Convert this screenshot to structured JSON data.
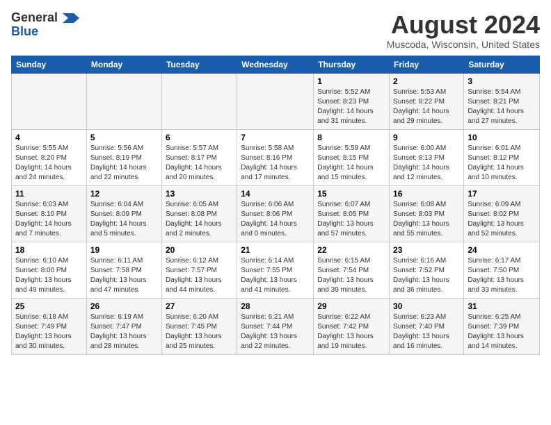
{
  "header": {
    "logo_line1": "General",
    "logo_line2": "Blue",
    "month_year": "August 2024",
    "location": "Muscoda, Wisconsin, United States"
  },
  "days_of_week": [
    "Sunday",
    "Monday",
    "Tuesday",
    "Wednesday",
    "Thursday",
    "Friday",
    "Saturday"
  ],
  "weeks": [
    [
      {
        "day": "",
        "info": ""
      },
      {
        "day": "",
        "info": ""
      },
      {
        "day": "",
        "info": ""
      },
      {
        "day": "",
        "info": ""
      },
      {
        "day": "1",
        "info": "Sunrise: 5:52 AM\nSunset: 8:23 PM\nDaylight: 14 hours\nand 31 minutes."
      },
      {
        "day": "2",
        "info": "Sunrise: 5:53 AM\nSunset: 8:22 PM\nDaylight: 14 hours\nand 29 minutes."
      },
      {
        "day": "3",
        "info": "Sunrise: 5:54 AM\nSunset: 8:21 PM\nDaylight: 14 hours\nand 27 minutes."
      }
    ],
    [
      {
        "day": "4",
        "info": "Sunrise: 5:55 AM\nSunset: 8:20 PM\nDaylight: 14 hours\nand 24 minutes."
      },
      {
        "day": "5",
        "info": "Sunrise: 5:56 AM\nSunset: 8:19 PM\nDaylight: 14 hours\nand 22 minutes."
      },
      {
        "day": "6",
        "info": "Sunrise: 5:57 AM\nSunset: 8:17 PM\nDaylight: 14 hours\nand 20 minutes."
      },
      {
        "day": "7",
        "info": "Sunrise: 5:58 AM\nSunset: 8:16 PM\nDaylight: 14 hours\nand 17 minutes."
      },
      {
        "day": "8",
        "info": "Sunrise: 5:59 AM\nSunset: 8:15 PM\nDaylight: 14 hours\nand 15 minutes."
      },
      {
        "day": "9",
        "info": "Sunrise: 6:00 AM\nSunset: 8:13 PM\nDaylight: 14 hours\nand 12 minutes."
      },
      {
        "day": "10",
        "info": "Sunrise: 6:01 AM\nSunset: 8:12 PM\nDaylight: 14 hours\nand 10 minutes."
      }
    ],
    [
      {
        "day": "11",
        "info": "Sunrise: 6:03 AM\nSunset: 8:10 PM\nDaylight: 14 hours\nand 7 minutes."
      },
      {
        "day": "12",
        "info": "Sunrise: 6:04 AM\nSunset: 8:09 PM\nDaylight: 14 hours\nand 5 minutes."
      },
      {
        "day": "13",
        "info": "Sunrise: 6:05 AM\nSunset: 8:08 PM\nDaylight: 14 hours\nand 2 minutes."
      },
      {
        "day": "14",
        "info": "Sunrise: 6:06 AM\nSunset: 8:06 PM\nDaylight: 14 hours\nand 0 minutes."
      },
      {
        "day": "15",
        "info": "Sunrise: 6:07 AM\nSunset: 8:05 PM\nDaylight: 13 hours\nand 57 minutes."
      },
      {
        "day": "16",
        "info": "Sunrise: 6:08 AM\nSunset: 8:03 PM\nDaylight: 13 hours\nand 55 minutes."
      },
      {
        "day": "17",
        "info": "Sunrise: 6:09 AM\nSunset: 8:02 PM\nDaylight: 13 hours\nand 52 minutes."
      }
    ],
    [
      {
        "day": "18",
        "info": "Sunrise: 6:10 AM\nSunset: 8:00 PM\nDaylight: 13 hours\nand 49 minutes."
      },
      {
        "day": "19",
        "info": "Sunrise: 6:11 AM\nSunset: 7:58 PM\nDaylight: 13 hours\nand 47 minutes."
      },
      {
        "day": "20",
        "info": "Sunrise: 6:12 AM\nSunset: 7:57 PM\nDaylight: 13 hours\nand 44 minutes."
      },
      {
        "day": "21",
        "info": "Sunrise: 6:14 AM\nSunset: 7:55 PM\nDaylight: 13 hours\nand 41 minutes."
      },
      {
        "day": "22",
        "info": "Sunrise: 6:15 AM\nSunset: 7:54 PM\nDaylight: 13 hours\nand 39 minutes."
      },
      {
        "day": "23",
        "info": "Sunrise: 6:16 AM\nSunset: 7:52 PM\nDaylight: 13 hours\nand 36 minutes."
      },
      {
        "day": "24",
        "info": "Sunrise: 6:17 AM\nSunset: 7:50 PM\nDaylight: 13 hours\nand 33 minutes."
      }
    ],
    [
      {
        "day": "25",
        "info": "Sunrise: 6:18 AM\nSunset: 7:49 PM\nDaylight: 13 hours\nand 30 minutes."
      },
      {
        "day": "26",
        "info": "Sunrise: 6:19 AM\nSunset: 7:47 PM\nDaylight: 13 hours\nand 28 minutes."
      },
      {
        "day": "27",
        "info": "Sunrise: 6:20 AM\nSunset: 7:45 PM\nDaylight: 13 hours\nand 25 minutes."
      },
      {
        "day": "28",
        "info": "Sunrise: 6:21 AM\nSunset: 7:44 PM\nDaylight: 13 hours\nand 22 minutes."
      },
      {
        "day": "29",
        "info": "Sunrise: 6:22 AM\nSunset: 7:42 PM\nDaylight: 13 hours\nand 19 minutes."
      },
      {
        "day": "30",
        "info": "Sunrise: 6:23 AM\nSunset: 7:40 PM\nDaylight: 13 hours\nand 16 minutes."
      },
      {
        "day": "31",
        "info": "Sunrise: 6:25 AM\nSunset: 7:39 PM\nDaylight: 13 hours\nand 14 minutes."
      }
    ]
  ]
}
